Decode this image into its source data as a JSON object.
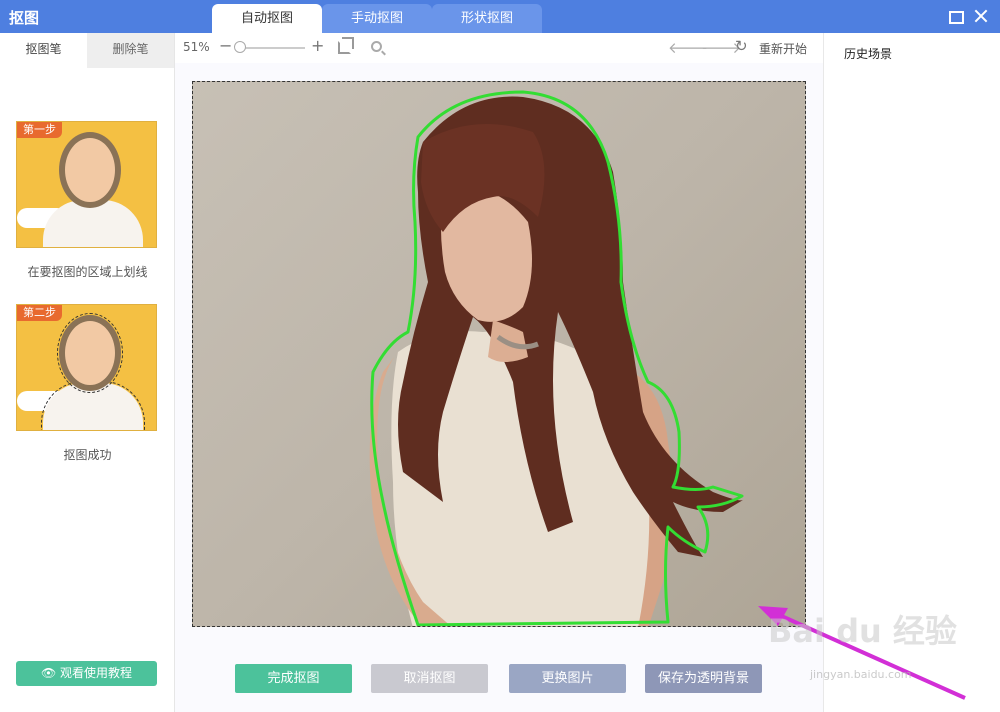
{
  "app": {
    "title": "抠图"
  },
  "tabs": [
    {
      "label": "自动抠图",
      "active": true
    },
    {
      "label": "手动抠图",
      "active": false
    },
    {
      "label": "形状抠图",
      "active": false
    }
  ],
  "window_controls": {
    "maximize_icon": "maximize-icon",
    "close_icon": "close-icon"
  },
  "left_panel": {
    "tabs": [
      {
        "label": "抠图笔",
        "active": true
      },
      {
        "label": "删除笔",
        "active": false
      }
    ],
    "steps": [
      {
        "tag": "第一步",
        "caption": "在要抠图的区域上划线"
      },
      {
        "tag": "第二步",
        "caption": "抠图成功"
      }
    ],
    "tutorial_button": "观看使用教程",
    "tutorial_icon": "eye-icon"
  },
  "toolbar": {
    "zoom": "51%",
    "zoom_minus": "−",
    "zoom_plus": "+",
    "zoom_level": 0.05,
    "undo_icon": "arrow-left-icon",
    "redo_icon": "arrow-right-icon",
    "restart_icon": "refresh-icon",
    "restart_label": "重新开始"
  },
  "actions": {
    "finish": "完成抠图",
    "cancel": "取消抠图",
    "change_image": "更换图片",
    "save_transparent": "保存为透明背景"
  },
  "right_panel": {
    "title": "历史场景"
  },
  "watermark": {
    "text": "Bai du 经验",
    "url": "jingyan.baidu.com"
  },
  "colors": {
    "titlebar": "#4e7fe0",
    "accent_green": "#4cc29b",
    "button_disabled": "#c9c9d0",
    "button_change": "#9aa6c4",
    "button_save": "#8e97b7",
    "selection_outline": "#33dd33",
    "annotation_arrow": "#d22fd6"
  }
}
